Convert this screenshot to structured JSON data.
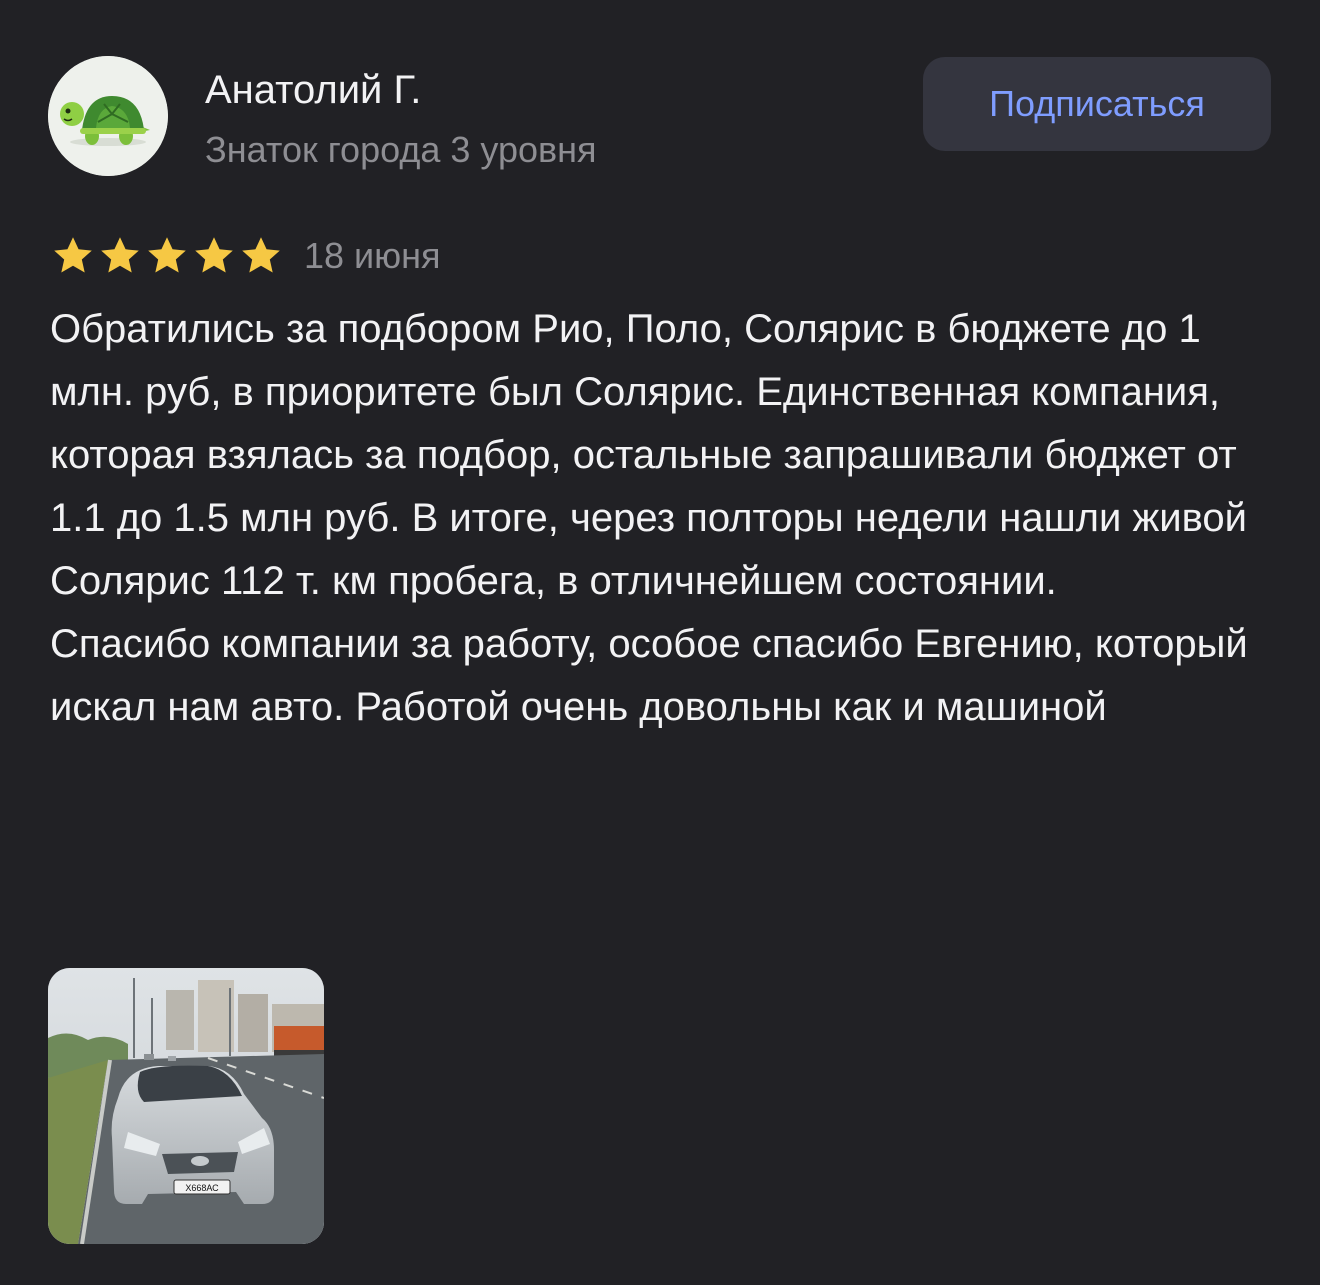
{
  "author": {
    "name": "Анатолий Г.",
    "level": "Знаток города 3 уровня",
    "avatar_icon": "turtle-icon"
  },
  "subscribe": {
    "label": "Подписаться",
    "color": "#7f9dff"
  },
  "review": {
    "rating": 5,
    "rating_max": 5,
    "date": "18 июня",
    "paragraphs": [
      "Обратились за подбором Рио, Поло, Солярис в бюджете до 1 млн. руб, в приоритете был Солярис. Единственная компания, которая взялась за подбор, остальные запрашивали бюджет от 1.1 до 1.5 млн руб. В итоге, через полторы недели нашли живой Солярис 112 т. км пробега, в отличнейшем состоянии.",
      "Спасибо компании за работу, особое спасибо Евгению, который искал нам авто. Работой очень довольны как и машиной"
    ],
    "photo": {
      "plate": "Х668АС"
    }
  },
  "colors": {
    "background": "#212125",
    "star": "#f6c844",
    "secondary_text": "#8e8e93"
  }
}
